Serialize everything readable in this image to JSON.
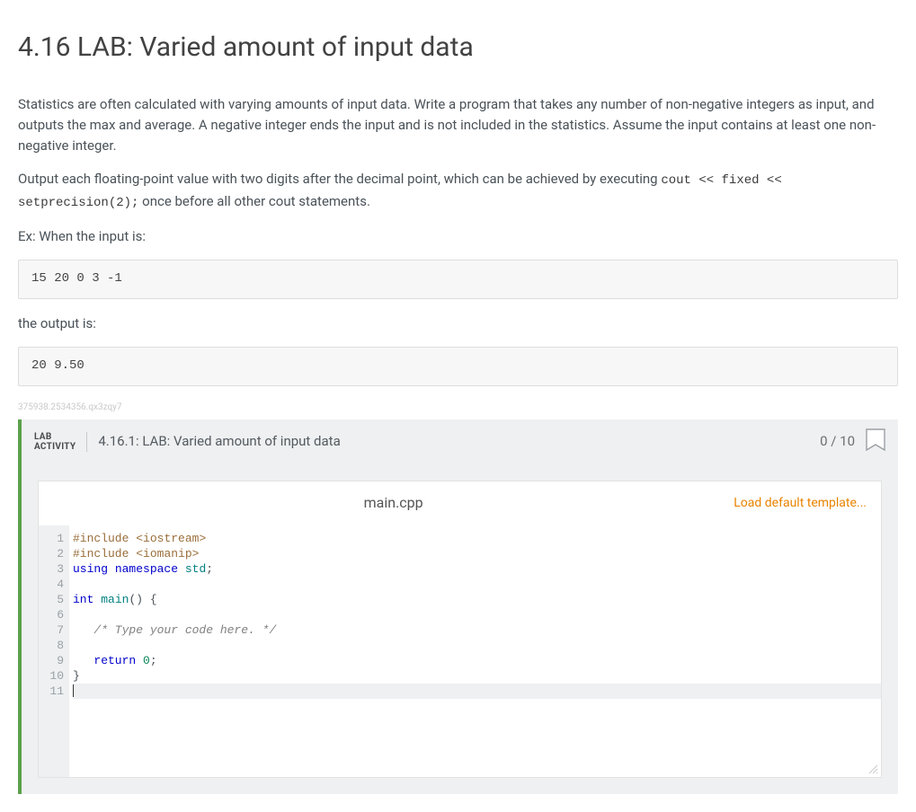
{
  "heading": "4.16 LAB: Varied amount of input data",
  "paragraph1": "Statistics are often calculated with varying amounts of input data. Write a program that takes any number of non-negative integers as input, and outputs the max and average. A negative integer ends the input and is not included in the statistics. Assume the input contains at least one non-negative integer.",
  "paragraph2_pre": "Output each floating-point value with two digits after the decimal point, which can be achieved by executing ",
  "paragraph2_code": "cout << fixed << setprecision(2);",
  "paragraph2_post": " once before all other cout statements.",
  "example_input_label": "Ex: When the input is:",
  "example_input": "15 20 0 3 -1",
  "example_output_label": "the output is:",
  "example_output": "20 9.50",
  "watermark": "375938.2534356.qx3zqy7",
  "activity": {
    "badge_line1": "LAB",
    "badge_line2": "ACTIVITY",
    "title": "4.16.1: LAB: Varied amount of input data",
    "score": "0 / 10"
  },
  "editor": {
    "filename": "main.cpp",
    "load_template_label": "Load default template...",
    "lines": [
      "#include <iostream>",
      "#include <iomanip>",
      "using namespace std;",
      "",
      "int main() {",
      "",
      "   /* Type your code here. */",
      "",
      "   return 0;",
      "}",
      ""
    ]
  }
}
